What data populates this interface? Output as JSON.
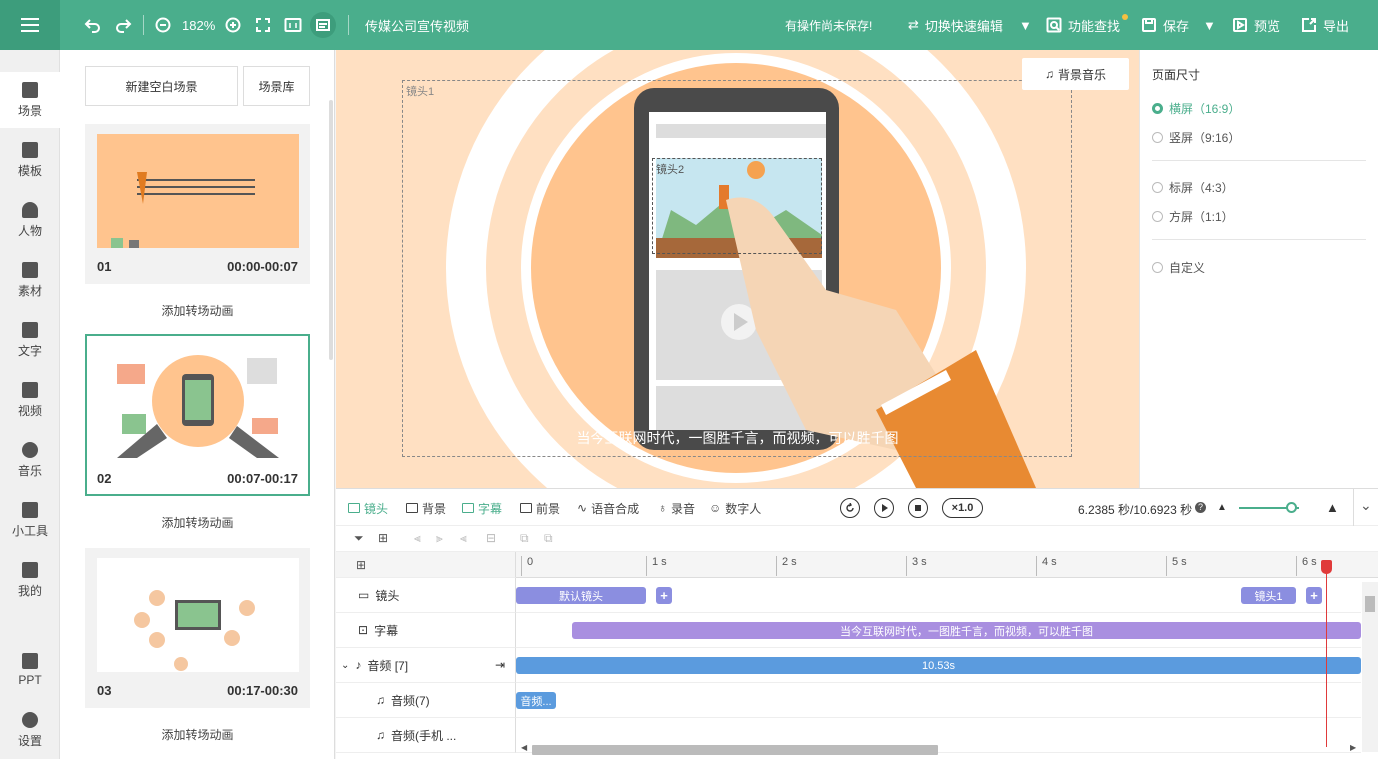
{
  "topbar": {
    "zoom": "182%",
    "project_title": "传媒公司宣传视频",
    "unsaved_notice": "有操作尚未保存!",
    "quick_edit_label": "切换快速编辑",
    "feature_search_label": "功能查找",
    "save_label": "保存",
    "preview_label": "预览",
    "export_label": "导出"
  },
  "nav": {
    "scene": "场景",
    "template": "模板",
    "character": "人物",
    "material": "素材",
    "text": "文字",
    "video": "视频",
    "music": "音乐",
    "tools": "小工具",
    "mine": "我的",
    "ppt": "PPT",
    "settings": "设置"
  },
  "scenes": {
    "new_blank": "新建空白场景",
    "library": "场景库",
    "add_transition": "添加转场动画",
    "items": [
      {
        "num": "01",
        "time": "00:00-00:07"
      },
      {
        "num": "02",
        "time": "00:07-00:17"
      },
      {
        "num": "03",
        "time": "00:17-00:30"
      }
    ]
  },
  "canvas": {
    "bgm_label": "背景音乐",
    "frame1_label": "镜头1",
    "frame2_label": "镜头2",
    "subtitle": "当今互联网时代，一图胜千言，而视频，可以胜千图"
  },
  "page_size": {
    "title": "页面尺寸",
    "landscape": "横屏（16:9）",
    "portrait": "竖屏（9:16）",
    "standard": "标屏（4:3）",
    "square": "方屏（1:1）",
    "custom": "自定义"
  },
  "timeline": {
    "tool_camera": "镜头",
    "tool_background": "背景",
    "tool_subtitle": "字幕",
    "tool_foreground": "前景",
    "tool_tts": "语音合成",
    "tool_record": "录音",
    "tool_digital_human": "数字人",
    "speed": "×1.0",
    "time_display": "6.2385 秒/10.6923 秒",
    "ruler_ticks": [
      "0",
      "1 s",
      "2 s",
      "3 s",
      "4 s",
      "5 s",
      "6 s"
    ],
    "tracks": {
      "camera_label": "镜头",
      "subtitle_label": "字幕",
      "audio_label": "音频 [7]",
      "audio_sub1": "音频(7)",
      "audio_sub2": "音频(手机 ..."
    },
    "clips": {
      "default_camera": "默认镜头",
      "camera1": "镜头1",
      "subtitle_clip": "当今互联网时代，一图胜千言，而视频，可以胜千图",
      "audio_clip": "10.53s",
      "audio_small": "音频..."
    }
  },
  "colors": {
    "brand": "#4aae8c",
    "camera_clip": "#8b8ee0",
    "subtitle_clip": "#a98fe0",
    "audio_clip": "#5b9bde",
    "playhead": "#e03a3a",
    "canvas_bg": "#ffe0c2"
  }
}
